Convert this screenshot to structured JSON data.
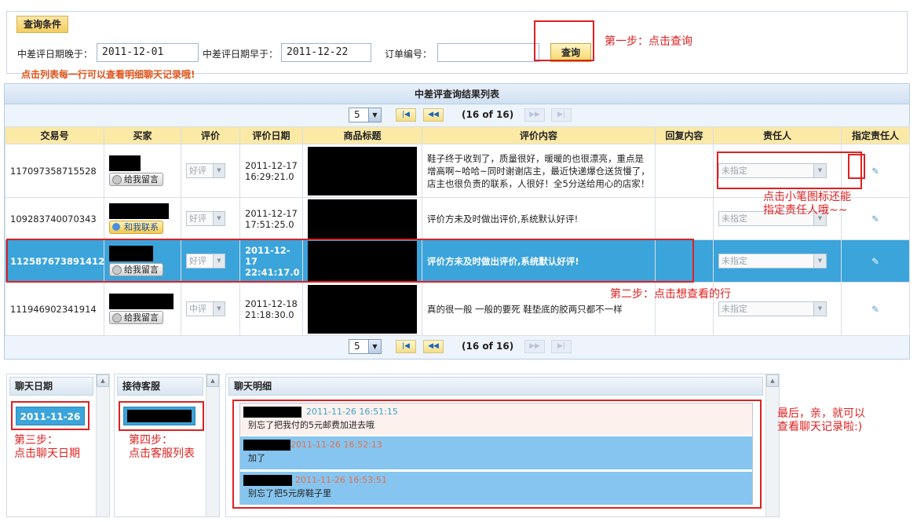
{
  "query": {
    "section_title": "查询条件",
    "date_after_label": "中差评日期晚于：",
    "date_after_value": "2011-12-01",
    "date_before_label": "中差评日期早于：",
    "date_before_value": "2011-12-22",
    "order_label": "订单编号：",
    "order_value": "",
    "search_button": "查询",
    "hint": "点击列表每一行可以查看明细聊天记录哦!"
  },
  "annotations": {
    "step1": "第一步：点击查询",
    "pen_note": "点击小笔图标还能\n指定责任人哦~~",
    "step2": "第二步：点击想查看的行",
    "step3": "第三步：\n点击聊天日期",
    "step4": "第四步：\n点击客服列表",
    "final": "最后，亲，就可以\n查看聊天记录啦:)"
  },
  "results": {
    "title": "中差评查询结果列表",
    "page_size": "5",
    "page_info": "(16 of 16)",
    "columns": [
      "交易号",
      "买家",
      "评价",
      "评价日期",
      "商品标题",
      "评价内容",
      "回复内容",
      "责任人",
      "指定责任人"
    ],
    "rows": [
      {
        "trade_no": "117097358715528",
        "buyer_button": "给我留言",
        "rating": "好评",
        "date": "2011-12-17",
        "time": "16:29:21.0",
        "content": "鞋子终于收到了，质量很好，暖暖的也很漂亮，重点是增高啊~哈哈~同时谢谢店主，最近快递爆仓送货慢了，店主也很负责的联系，人很好！全5分送给用心的店家！",
        "reply": "",
        "owner": "未指定"
      },
      {
        "trade_no": "109283740070343",
        "buyer_button": "和我联系",
        "rating": "好评",
        "date": "2011-12-17",
        "time": "17:51:25.0",
        "content": "评价方未及时做出评价,系统默认好评!",
        "reply": "",
        "owner": "未指定"
      },
      {
        "trade_no": "112587673891412",
        "buyer_button": "给我留言",
        "rating": "好评",
        "date": "2011-12-17",
        "time": "22:41:17.0",
        "content": "评价方未及时做出评价,系统默认好评!",
        "reply": "",
        "owner": "未指定"
      },
      {
        "trade_no": "111946902341914",
        "buyer_button": "给我留言",
        "rating": "中评",
        "date": "2011-12-18",
        "time": "21:18:30.0",
        "content": "真的很一般 一般的要死 鞋垫底的胶两只都不一样",
        "reply": "",
        "owner": "未指定"
      }
    ]
  },
  "chat": {
    "date_panel_title": "聊天日期",
    "date_item": "2011-11-26",
    "agent_panel_title": "接待客服",
    "detail_panel_title": "聊天明细",
    "messages": [
      {
        "time": "2011-11-26 16:51:15",
        "text": "别忘了把我付的5元邮费加进去哦"
      },
      {
        "time": "2011-11-26 16:52:13",
        "text": "加了"
      },
      {
        "time": "2011-11-26 16:53:51",
        "text": "别忘了把5元房鞋子里"
      }
    ]
  },
  "colors": {
    "accent_red": "#e02020",
    "selected_row": "#3ba4db",
    "header_yellow": "#fbe9a6",
    "hint_orange": "#e0531a"
  }
}
